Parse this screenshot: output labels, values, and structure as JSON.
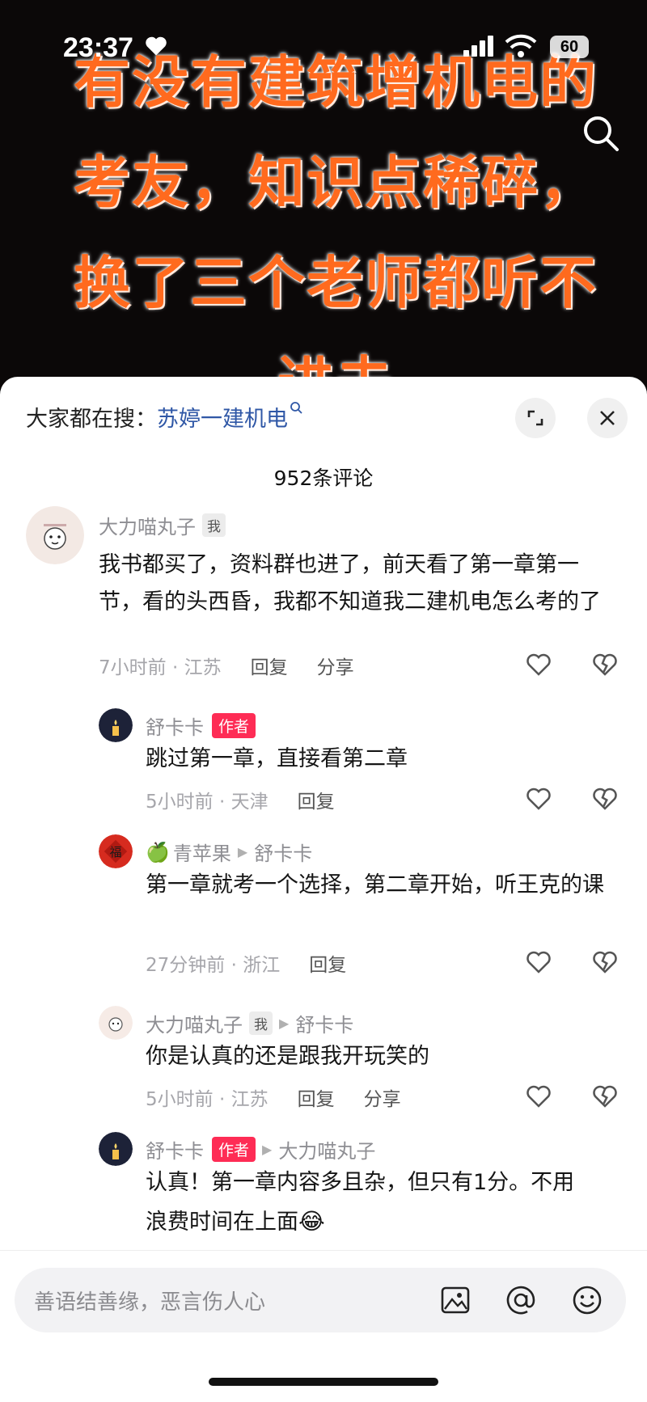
{
  "status": {
    "time": "23:37",
    "battery": "60"
  },
  "video": {
    "caption_lines": [
      "有没有建筑增机电的",
      "考友，知识点稀碎，",
      "换了三个老师都听不",
      "进去"
    ]
  },
  "sheet": {
    "suggest_label": "大家都在搜：",
    "suggest_keyword": "苏婷一建机电",
    "comment_count": "952条评论"
  },
  "comments": [
    {
      "author": "大力喵丸子",
      "tag": "我",
      "text": "我书都买了，资料群也进了，前天看了第一章第一节，看的头西昏，我都不知道我二建机电怎么考的了",
      "meta": "7小时前 · 江苏",
      "reply": "回复",
      "share": "分享"
    },
    {
      "author": "舒卡卡",
      "tag": "作者",
      "text": "跳过第一章，直接看第二章",
      "meta": "5小时前 · 天津",
      "reply": "回复"
    },
    {
      "author": "青苹果",
      "emoji": "🍏",
      "reply_to": "舒卡卡",
      "text": "第一章就考一个选择，第二章开始，听王克的课",
      "meta": "27分钟前 · 浙江",
      "reply": "回复"
    },
    {
      "author": "大力喵丸子",
      "tag": "我",
      "reply_to": "舒卡卡",
      "text": "你是认真的还是跟我开玩笑的",
      "meta": "5小时前 · 江苏",
      "reply": "回复",
      "share": "分享"
    },
    {
      "author": "舒卡卡",
      "tag": "作者",
      "reply_to": "大力喵丸子",
      "text_line1": "认真！第一章内容多且杂，但只有1分。不用",
      "text_line2": "浪费时间在上面",
      "emoji": "😂"
    }
  ],
  "input": {
    "placeholder": "善语结善缘，恶言伤人心"
  },
  "colors": {
    "accent_author": "#fe2c55",
    "keyword": "#2f57a6",
    "caption": "#ff6a1e"
  }
}
